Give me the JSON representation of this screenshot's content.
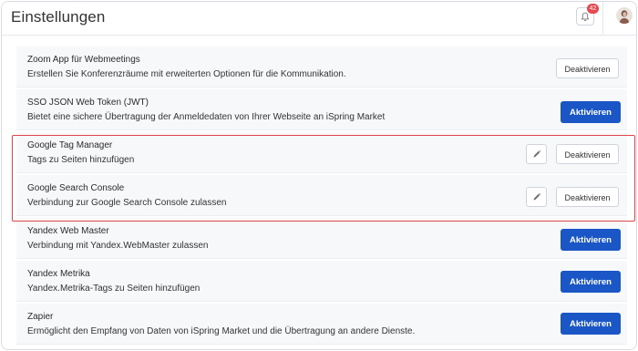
{
  "header": {
    "title": "Einstellungen",
    "notification_count": "42"
  },
  "integrations": [
    {
      "title": "Zoom App für Webmeetings",
      "description": "Erstellen Sie Konferenzräume mit erweiterten Optionen für die Kommunikation.",
      "button_label": "Deaktivieren",
      "state": "active"
    },
    {
      "title": "SSO JSON Web Token (JWT)",
      "description": "Bietet eine sichere Übertragung der Anmeldedaten von Ihrer Webseite an iSpring Market",
      "button_label": "Aktivieren",
      "state": "inactive"
    },
    {
      "title": "Google Tag Manager",
      "description": "Tags zu Seiten hinzufügen",
      "button_label": "Deaktivieren",
      "state": "active",
      "editable": true
    },
    {
      "title": "Google Search Console",
      "description": "Verbindung zur Google Search Console zulassen",
      "button_label": "Deaktivieren",
      "state": "active",
      "editable": true
    },
    {
      "title": "Yandex Web Master",
      "description": "Verbindung mit Yandex.WebMaster zulassen",
      "button_label": "Aktivieren",
      "state": "inactive"
    },
    {
      "title": "Yandex Metrika",
      "description": "Yandex.Metrika-Tags zu Seiten hinzufügen",
      "button_label": "Aktivieren",
      "state": "inactive"
    },
    {
      "title": "Zapier",
      "description": "Ermöglicht den Empfang von Daten von iSpring Market und die Übertragung an andere Dienste.",
      "button_label": "Aktivieren",
      "state": "inactive"
    }
  ],
  "colors": {
    "primary_button": "#1a56c5",
    "highlight_border": "#e0474c",
    "badge": "#e5484d",
    "row_background": "#f7f8fa"
  },
  "icons": {
    "notification": "bell-icon",
    "edit": "pencil-icon",
    "user": "avatar"
  }
}
